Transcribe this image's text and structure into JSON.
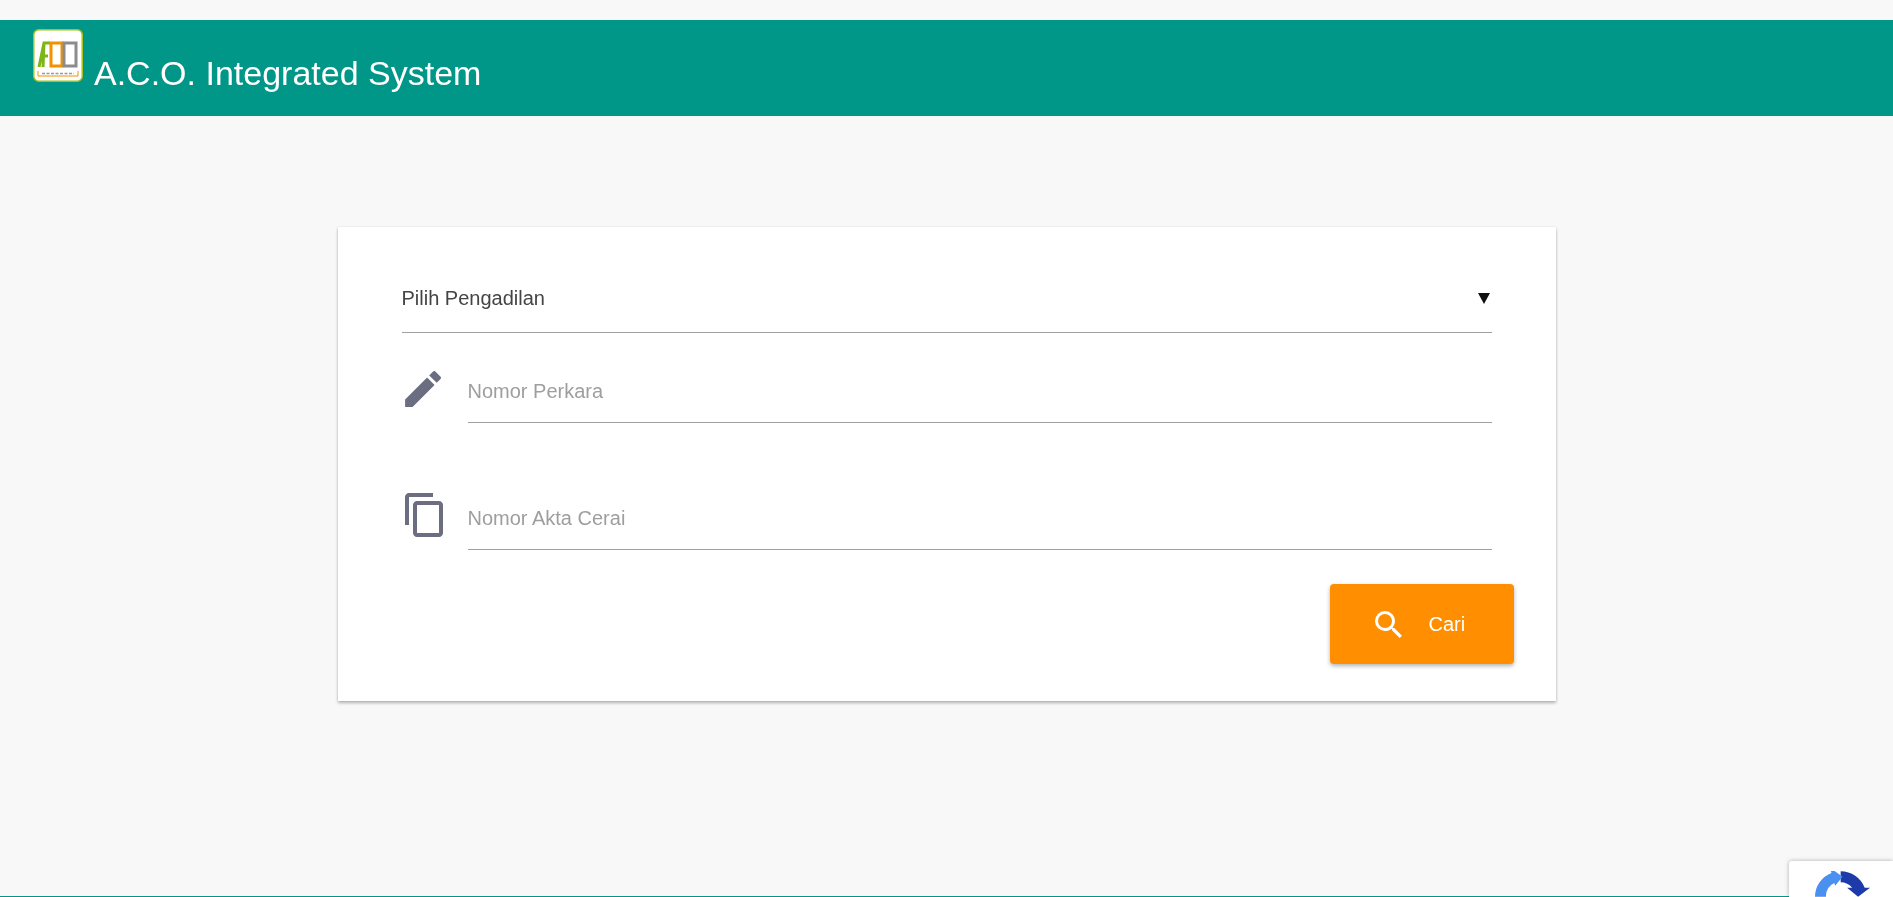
{
  "header": {
    "title": "A.C.O. Integrated System"
  },
  "search_form": {
    "court_select": {
      "value": "Pilih Pengadilan"
    },
    "fields": [
      {
        "kind": "edit",
        "placeholder": "Nomor Perkara"
      },
      {
        "kind": "copy",
        "placeholder": "Nomor Akta Cerai"
      }
    ],
    "submit_button": {
      "label": "Cari"
    }
  }
}
